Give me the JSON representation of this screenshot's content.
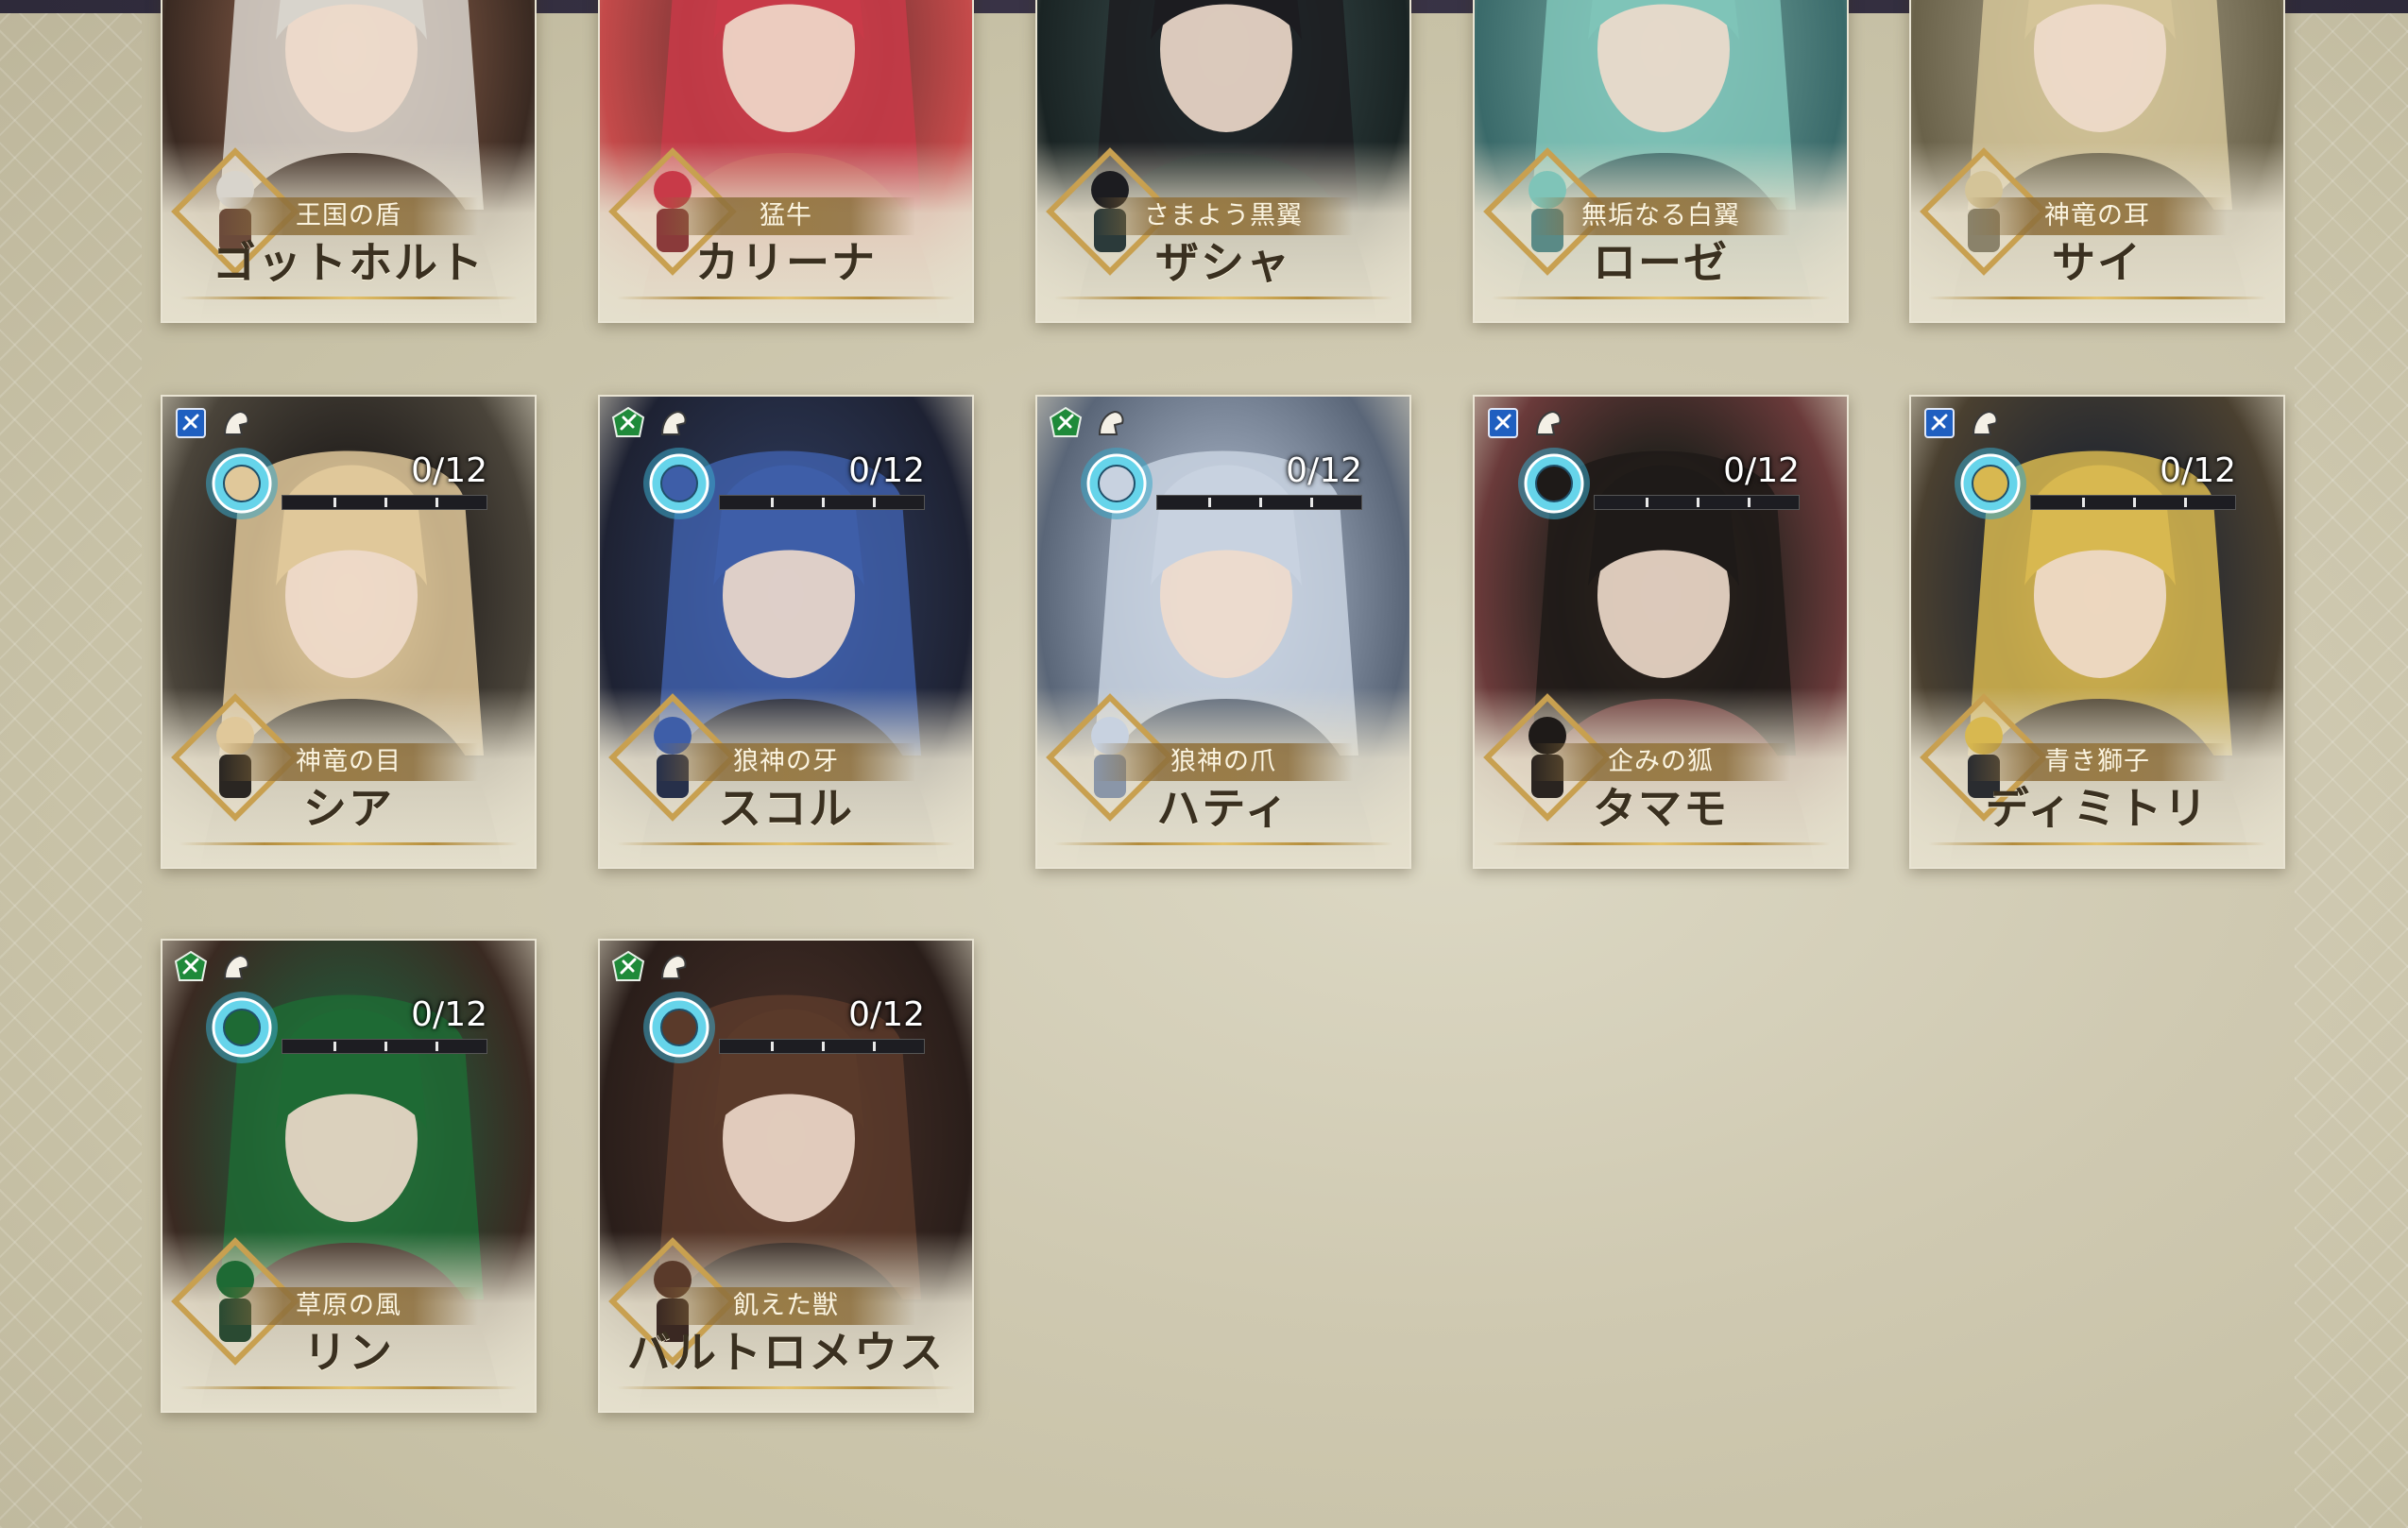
{
  "cards": [
    {
      "title": "王国の盾",
      "name": "ゴットホルト",
      "palette": [
        "#6b4a3a",
        "#3a2a22",
        "#a08060"
      ],
      "hair": "#d8d4cc",
      "icons": [],
      "progress": null
    },
    {
      "title": "猛牛",
      "name": "カリーナ",
      "palette": [
        "#8a3a3a",
        "#c44a4a",
        "#e06a6a"
      ],
      "hair": "#c83a48",
      "icons": [],
      "progress": null
    },
    {
      "title": "さまよう黒翼",
      "name": "ザシャ",
      "palette": [
        "#2b3a3a",
        "#1a2424",
        "#2f7a7a"
      ],
      "hair": "#1c1c20",
      "icons": [],
      "progress": null
    },
    {
      "title": "無垢なる白翼",
      "name": "ローゼ",
      "palette": [
        "#5a8a86",
        "#3a6a6a",
        "#8ec6c0"
      ],
      "hair": "#7fc4b8",
      "icons": [],
      "progress": null
    },
    {
      "title": "神竜の耳",
      "name": "サイ",
      "palette": [
        "#8a826a",
        "#6a624a",
        "#c8b890"
      ],
      "hair": "#d4c498",
      "icons": [],
      "progress": null
    },
    {
      "title": "神竜の目",
      "name": "シア",
      "palette": [
        "#2a2622",
        "#4a443a",
        "#d8c8a0"
      ],
      "hair": "#e0c89a",
      "icons": [
        "blue-magic-icon",
        "wing-icon"
      ],
      "progress": {
        "current": 0,
        "max": 12,
        "label": "0/12"
      }
    },
    {
      "title": "狼神の牙",
      "name": "スコル",
      "palette": [
        "#27304a",
        "#1e2233",
        "#4a68b8"
      ],
      "hair": "#3e5ea8",
      "icons": [
        "green-leaf-icon",
        "horse-icon"
      ],
      "progress": {
        "current": 0,
        "max": 12,
        "label": "0/12"
      }
    },
    {
      "title": "狼神の爪",
      "name": "ハティ",
      "palette": [
        "#8a96a8",
        "#5a6678",
        "#d4dde8"
      ],
      "hair": "#c8d2e0",
      "icons": [
        "green-leaf-icon",
        "horse-icon"
      ],
      "progress": {
        "current": 0,
        "max": 12,
        "label": "0/12"
      }
    },
    {
      "title": "企みの狐",
      "name": "タマモ",
      "palette": [
        "#2a2420",
        "#6a3a3a",
        "#8a6a4a"
      ],
      "hair": "#1e1a18",
      "icons": [
        "blue-staff-icon",
        "infantry-icon"
      ],
      "progress": {
        "current": 0,
        "max": 12,
        "label": "0/12"
      }
    },
    {
      "title": "青き獅子",
      "name": "ディミトリ",
      "palette": [
        "#2a2c30",
        "#4a4030",
        "#a88a40"
      ],
      "hair": "#d8b850",
      "icons": [
        "blue-lance-icon",
        "infantry-icon"
      ],
      "progress": {
        "current": 0,
        "max": 12,
        "label": "0/12"
      }
    },
    {
      "title": "草原の風",
      "name": "リン",
      "palette": [
        "#2a4a32",
        "#3a2a22",
        "#5aa86a"
      ],
      "hair": "#1e6a34",
      "icons": [
        "green-bow-icon",
        "infantry-icon"
      ],
      "progress": {
        "current": 0,
        "max": 12,
        "label": "0/12"
      }
    },
    {
      "title": "飢えた獣",
      "name": "バルトロメウス",
      "palette": [
        "#3a2822",
        "#2a1e1a",
        "#7a5040"
      ],
      "hair": "#5a3a2a",
      "icons": [
        "green-axe-icon",
        "armor-icon"
      ],
      "progress": {
        "current": 0,
        "max": 12,
        "label": "0/12"
      }
    }
  ],
  "colors": {
    "ribbon": "#9a7a44",
    "gold": "#e5c36c",
    "progress_fill": "#5fd0e8",
    "green_badge": "#1f8a3a",
    "blue_badge": "#1f5fc0"
  }
}
